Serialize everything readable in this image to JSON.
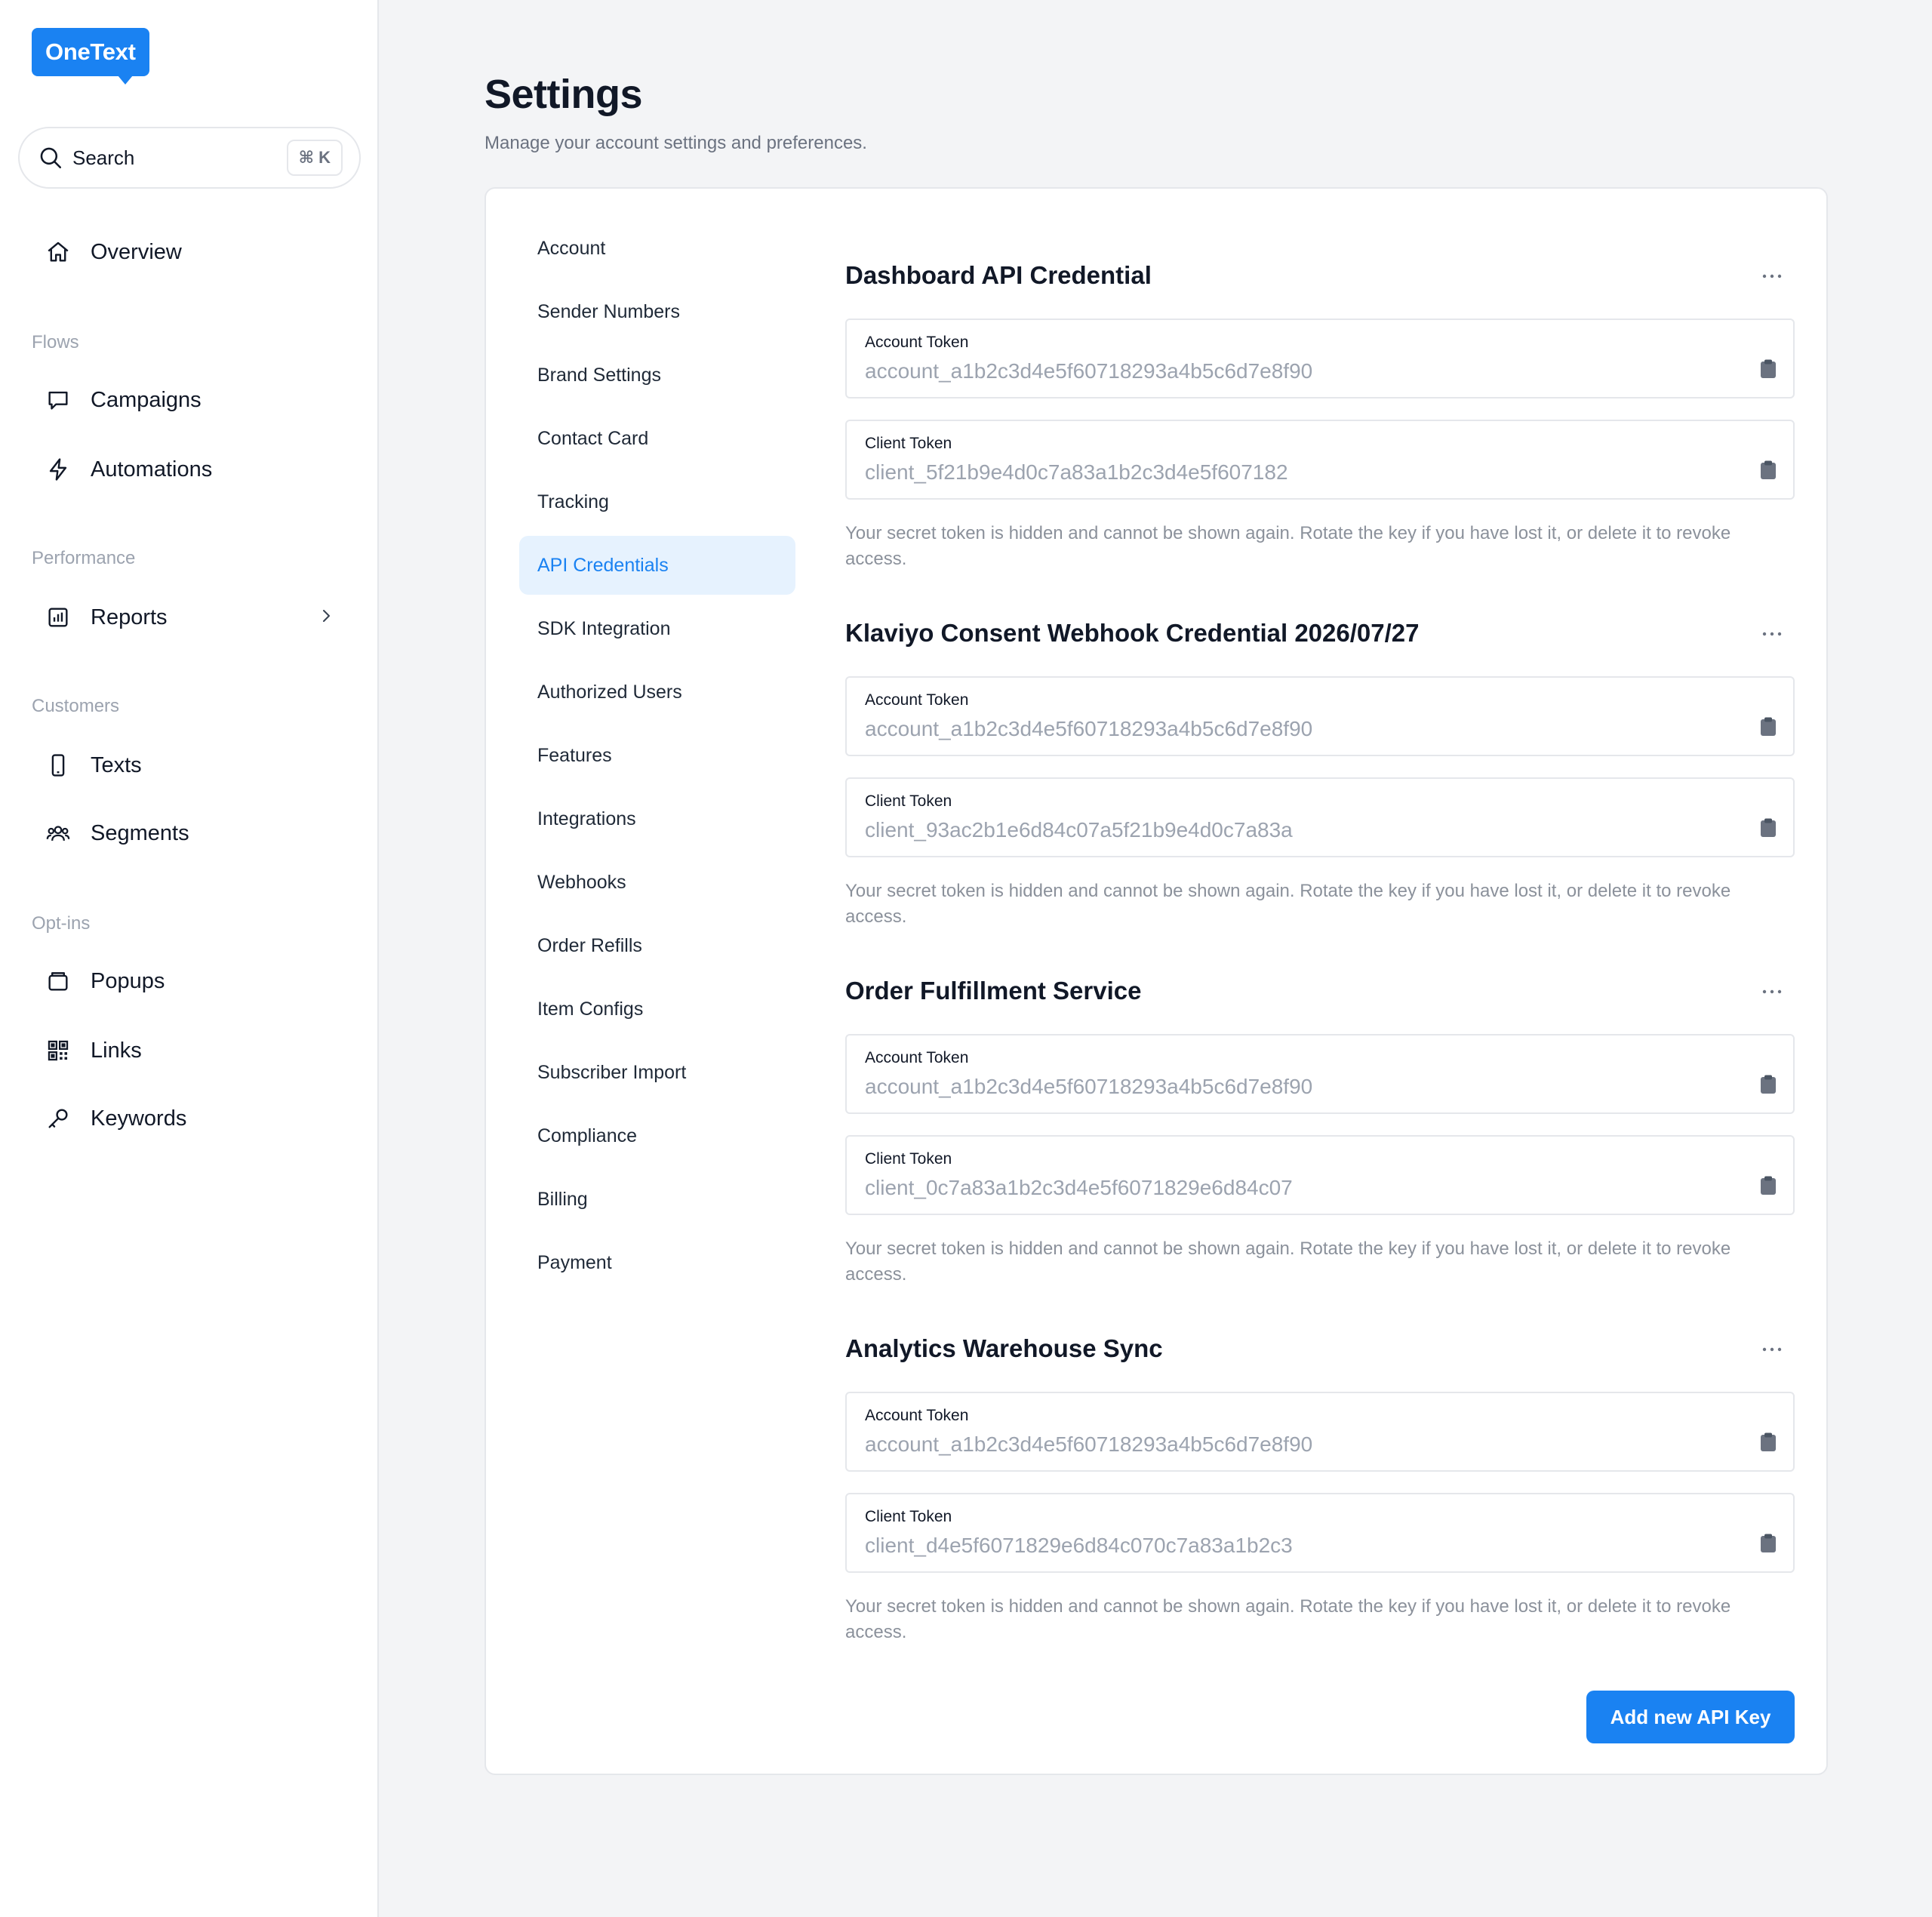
{
  "app": {
    "logo": "OneText"
  },
  "search": {
    "label": "Search",
    "shortcut": "⌘ K"
  },
  "sidebar": {
    "overview": "Overview",
    "groups": {
      "flows": "Flows",
      "performance": "Performance",
      "customers": "Customers",
      "optins": "Opt-ins"
    },
    "items": {
      "campaigns": "Campaigns",
      "automations": "Automations",
      "reports": "Reports",
      "texts": "Texts",
      "segments": "Segments",
      "popups": "Popups",
      "links": "Links",
      "keywords": "Keywords"
    }
  },
  "page": {
    "title": "Settings",
    "subtitle": "Manage your account settings and preferences."
  },
  "settings_nav": [
    "Account",
    "Sender Numbers",
    "Brand Settings",
    "Contact Card",
    "Tracking",
    "API Credentials",
    "SDK Integration",
    "Authorized Users",
    "Features",
    "Integrations",
    "Webhooks",
    "Order Refills",
    "Item Configs",
    "Subscriber Import",
    "Compliance",
    "Billing",
    "Payment"
  ],
  "settings_nav_active": "API Credentials",
  "credentials": [
    {
      "title": "Dashboard API Credential",
      "account_label": "Account Token",
      "account_token": "account_a1b2c3d4e5f60718293a4b5c6d7e8f90",
      "client_label": "Client Token",
      "client_token": "client_5f21b9e4d0c7a83a1b2c3d4e5f607182",
      "note": "Your secret token is hidden and cannot be shown again. Rotate the key if you have lost it, or delete it to revoke access."
    },
    {
      "title": "Klaviyo Consent Webhook Credential 2026/07/27",
      "account_label": "Account Token",
      "account_token": "account_a1b2c3d4e5f60718293a4b5c6d7e8f90",
      "client_label": "Client Token",
      "client_token": "client_93ac2b1e6d84c07a5f21b9e4d0c7a83a",
      "note": "Your secret token is hidden and cannot be shown again. Rotate the key if you have lost it, or delete it to revoke access."
    },
    {
      "title": "Order Fulfillment Service",
      "account_label": "Account Token",
      "account_token": "account_a1b2c3d4e5f60718293a4b5c6d7e8f90",
      "client_label": "Client Token",
      "client_token": "client_0c7a83a1b2c3d4e5f6071829e6d84c07",
      "note": "Your secret token is hidden and cannot be shown again. Rotate the key if you have lost it, or delete it to revoke access."
    },
    {
      "title": "Analytics Warehouse Sync",
      "account_label": "Account Token",
      "account_token": "account_a1b2c3d4e5f60718293a4b5c6d7e8f90",
      "client_label": "Client Token",
      "client_token": "client_d4e5f6071829e6d84c070c7a83a1b2c3",
      "note": "Your secret token is hidden and cannot be shown again. Rotate the key if you have lost it, or delete it to revoke access."
    }
  ],
  "actions": {
    "add_key": "Add new API Key"
  },
  "colors": {
    "accent": "#1a82f2",
    "active_bg": "#e6f2fe"
  }
}
